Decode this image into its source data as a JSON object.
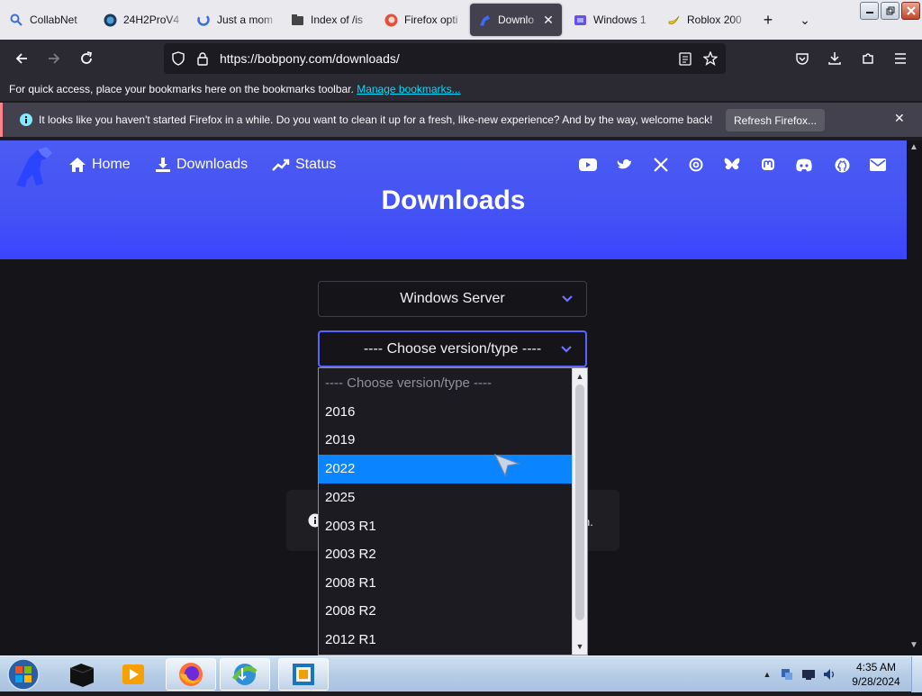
{
  "browser": {
    "tabs": [
      {
        "label": "CollabNet",
        "icon": "search-icon",
        "active": false
      },
      {
        "label": "24H2ProV4",
        "icon": "globe-icon",
        "active": false
      },
      {
        "label": "Just a mom",
        "icon": "spinner-icon",
        "active": false
      },
      {
        "label": "Index of /is",
        "icon": "folder-icon",
        "active": false
      },
      {
        "label": "Firefox opti",
        "icon": "firefox-icon",
        "active": false
      },
      {
        "label": "Downlo",
        "icon": "bobpony-icon",
        "active": true
      },
      {
        "label": "Windows 1",
        "icon": "windows-icon",
        "active": false
      },
      {
        "label": "Roblox 200",
        "icon": "banana-icon",
        "active": false
      }
    ],
    "url": "https://bobpony.com/downloads/",
    "bookmarks_text": "For quick access, place your bookmarks here on the bookmarks toolbar.",
    "bookmarks_link": "Manage bookmarks...",
    "notification_text": "It looks like you haven't started Firefox in a while. Do you want to clean it up for a fresh, like-new experience? And by the way, welcome back!",
    "notification_button": "Refresh Firefox...",
    "accent_color": "#0a84ff"
  },
  "site": {
    "nav": [
      {
        "label": "Home",
        "icon": "home-icon"
      },
      {
        "label": "Downloads",
        "icon": "download-icon"
      },
      {
        "label": "Status",
        "icon": "trend-icon"
      }
    ],
    "social_icons": [
      "youtube-icon",
      "twitter-icon",
      "x-icon",
      "threads-icon",
      "bluesky-icon",
      "mastodon-icon",
      "discord-icon",
      "github-icon",
      "mail-icon"
    ],
    "title": "Downloads",
    "os_select": "Windows Server",
    "version_select": "---- Choose version/type ----",
    "info_text_tail": "n.",
    "hero_color": "#4453f4"
  },
  "dropdown": {
    "options": [
      "---- Choose version/type ----",
      "2016",
      "2019",
      "2022",
      "2025",
      "2003 R1",
      "2003 R2",
      "2008 R1",
      "2008 R2",
      "2012 R1"
    ],
    "highlighted": "2022"
  },
  "taskbar": {
    "items": [
      "start-orb",
      "terminal-icon",
      "media-player-icon",
      "firefox-icon",
      "internet-download-manager-icon",
      "virtualbox-icon"
    ],
    "time": "4:35 AM",
    "date": "9/28/2024"
  }
}
